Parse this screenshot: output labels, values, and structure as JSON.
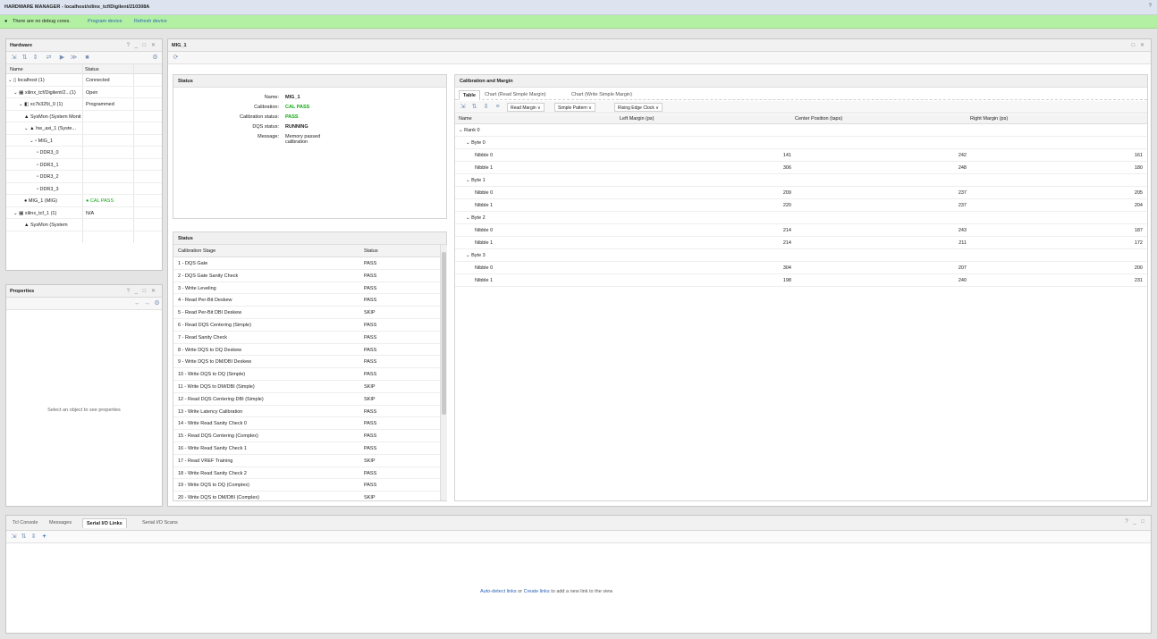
{
  "window": {
    "title": "HARDWARE MANAGER - localhost/xilinx_tcf/Digilent/210308A",
    "help": "?"
  },
  "notification": {
    "icon": "info-icon",
    "text": "There are no debug cores.",
    "link1": "Program device",
    "link2": "Refresh device"
  },
  "hardware": {
    "title": "Hardware",
    "controls": "? _ □ ✕",
    "tools": [
      "⇲",
      "⇅",
      "⇕",
      "⇄",
      "▶",
      "≫",
      "■"
    ],
    "settings_icon": "gear-icon",
    "columns": [
      "Name",
      "Status"
    ],
    "rows": [
      {
        "name": "⌄ ▯ localhost (1)",
        "status": "Connected",
        "indent": 2
      },
      {
        "name": "⌄ ▦ xilinx_tcf/Digilent/2...(1)",
        "status": "Open",
        "indent": 8
      },
      {
        "name": "⌄ ◧ xc7k325t_0 (1)",
        "status": "Programmed",
        "indent": 14
      },
      {
        "name": "▲ SysMon (System Monit",
        "status": "",
        "indent": 20
      },
      {
        "name": "⌄ ▲ hw_axi_1 (Syste...",
        "status": "",
        "indent": 20
      },
      {
        "name": "⌄ ▫ MIG_1",
        "status": "",
        "indent": 26
      },
      {
        "name": "▫ DDR3_0",
        "status": "",
        "indent": 34
      },
      {
        "name": "▫ DDR3_1",
        "status": "",
        "indent": 34
      },
      {
        "name": "▫ DDR3_2",
        "status": "",
        "indent": 34
      },
      {
        "name": "▫ DDR3_3",
        "status": "",
        "indent": 34
      },
      {
        "name": "● MIG_1 (MIG)",
        "status": "● CAL PASS",
        "indent": 20
      },
      {
        "name": "⌄ ▦ xilinx_tcf_1 (1)",
        "status": "N/A",
        "indent": 8
      },
      {
        "name": "▲ SysMon (System",
        "status": "",
        "indent": 20
      }
    ]
  },
  "properties": {
    "title": "Properties",
    "controls": "? _ □ ✕",
    "nav": [
      "←",
      "→",
      "⚙"
    ],
    "empty": "Select an object to see properties"
  },
  "mig": {
    "title": "MIG_1",
    "refresh_icon": "refresh-icon",
    "controls": "□ ✕",
    "status_box": {
      "title": "Status",
      "fields": [
        {
          "k": "Name:",
          "v": "MIG_1"
        },
        {
          "k": "Calibration:",
          "v": "CAL PASS"
        },
        {
          "k": "Calibration status:",
          "v": "PASS"
        },
        {
          "k": "DQS status:",
          "v": "RUNNING"
        },
        {
          "k": "Message:",
          "v": "Memory passed calibration"
        }
      ]
    },
    "stages": {
      "title": "Status",
      "columns": [
        "Calibration Stage",
        "Status"
      ],
      "rows": [
        [
          "1 - DQS Gate",
          "PASS"
        ],
        [
          "2 - DQS Gate Sanity Check",
          "PASS"
        ],
        [
          "3 - Write Leveling",
          "PASS"
        ],
        [
          "4 - Read Per-Bit Deskew",
          "PASS"
        ],
        [
          "5 - Read Per-Bit DBI Deskew",
          "SKIP"
        ],
        [
          "6 - Read DQS Centering (Simple)",
          "PASS"
        ],
        [
          "7 - Read Sanity Check",
          "PASS"
        ],
        [
          "8 - Write DQS to DQ Deskew",
          "PASS"
        ],
        [
          "9 - Write DQS to DM/DBI Deskew",
          "PASS"
        ],
        [
          "10 - Write DQS to DQ (Simple)",
          "PASS"
        ],
        [
          "11 - Write DQS to DM/DBI (Simple)",
          "SKIP"
        ],
        [
          "12 - Read DQS Centering DBI (Simple)",
          "SKIP"
        ],
        [
          "13 - Write Latency Calibration",
          "PASS"
        ],
        [
          "14 - Write Read Sanity Check 0",
          "PASS"
        ],
        [
          "15 - Read DQS Centering (Complex)",
          "PASS"
        ],
        [
          "16 - Write Read Sanity Check 1",
          "PASS"
        ],
        [
          "17 - Read VREF Training",
          "SKIP"
        ],
        [
          "18 - Write Read Sanity Check 2",
          "PASS"
        ],
        [
          "19 - Write DQS to DQ (Complex)",
          "PASS"
        ],
        [
          "20 - Write DQS to DM/DBI (Complex)",
          "SKIP"
        ]
      ]
    },
    "margin": {
      "title": "Calibration and Margin",
      "tabs": [
        "Table",
        "Chart (Read Simple Margin)",
        "Chart (Write Simple Margin)"
      ],
      "tools": [
        "⇲",
        "⇅",
        "⇕",
        "≡"
      ],
      "dropdowns": [
        "Read Margin",
        "Simple Pattern",
        "Rising Edge Clock"
      ],
      "columns": [
        "Name",
        "Left Margin (ps)",
        "Center Position (taps)",
        "Right Margin (ps)"
      ],
      "rows": [
        {
          "type": "rank",
          "name": "⌄ Rank 0"
        },
        {
          "type": "byte",
          "name": "⌄ Byte 0"
        },
        {
          "type": "nib",
          "name": "Nibble 0",
          "vals": [
            "141",
            "242",
            "161"
          ]
        },
        {
          "type": "nib",
          "name": "Nibble 1",
          "vals": [
            "306",
            "248",
            "180"
          ]
        },
        {
          "type": "byte",
          "name": "⌄ Byte 1"
        },
        {
          "type": "nib",
          "name": "Nibble 0",
          "vals": [
            "209",
            "237",
            "205"
          ]
        },
        {
          "type": "nib",
          "name": "Nibble 1",
          "vals": [
            "220",
            "237",
            "204"
          ]
        },
        {
          "type": "byte",
          "name": "⌄ Byte 2"
        },
        {
          "type": "nib",
          "name": "Nibble 0",
          "vals": [
            "214",
            "243",
            "187"
          ]
        },
        {
          "type": "nib",
          "name": "Nibble 1",
          "vals": [
            "214",
            "211",
            "172"
          ]
        },
        {
          "type": "byte",
          "name": "⌄ Byte 3"
        },
        {
          "type": "nib",
          "name": "Nibble 0",
          "vals": [
            "304",
            "207",
            "200"
          ]
        },
        {
          "type": "nib",
          "name": "Nibble 1",
          "vals": [
            "198",
            "240",
            "231"
          ]
        }
      ]
    }
  },
  "bottom": {
    "tabs": [
      "Tcl Console",
      "Messages",
      "Serial I/O Links",
      "Serial I/O Scans"
    ],
    "selected": 2,
    "controls": "? _ □",
    "tools": [
      "⇲",
      "⇅",
      "⇕",
      "+"
    ],
    "msg_link": "Auto-detect links",
    "msg_or": "or",
    "msg_link2": "Create links",
    "msg_rest": "to add a new link to the view"
  }
}
